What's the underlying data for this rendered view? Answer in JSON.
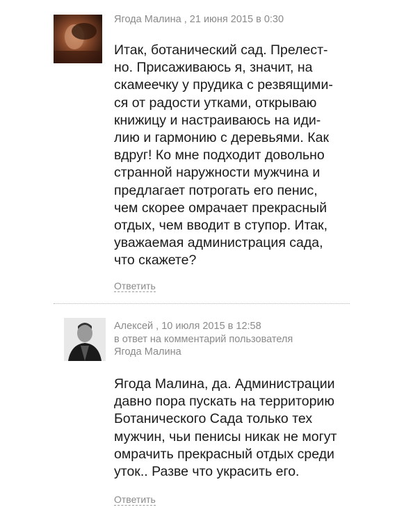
{
  "comments": [
    {
      "author": "Ягода Малина",
      "date": "21 июня 2015 в 0:30",
      "body_lines": [
        "Итак, ботанический сад. Прелест-",
        "но. Присаживаюсь я, значит, на",
        "скамеечку у прудика с резвящими-",
        "ся от радости утками, открываю",
        "книжицу и настраиваюсь на иди-",
        "лию и гармонию с деревьями. Как",
        "вдруг! Ко мне подходит довольно",
        "странной наружности мужчина и",
        "предлагает потрогать его пенис,",
        "чем скорее омрачает прекрасный",
        "отдых, чем вводит в ступор. Итак,",
        "уважаемая администрация сада,",
        "что скажете?"
      ],
      "reply_label": "Ответить"
    },
    {
      "author": "Алексей",
      "date": "10 июля 2015 в 12:58",
      "reply_to_text": "в ответ на комментарий пользователя",
      "reply_to_user": "Ягода Малина",
      "body_lines": [
        "Ягода Малина, да. Администрации",
        "давно пора пускать на территорию",
        "Ботанического Сада только тех",
        "мужчин, чьи пенисы никак не могут",
        "омрачить прекрасный отдых среди",
        "уток.. Разве что украсить его."
      ],
      "reply_label": "Ответить"
    }
  ]
}
